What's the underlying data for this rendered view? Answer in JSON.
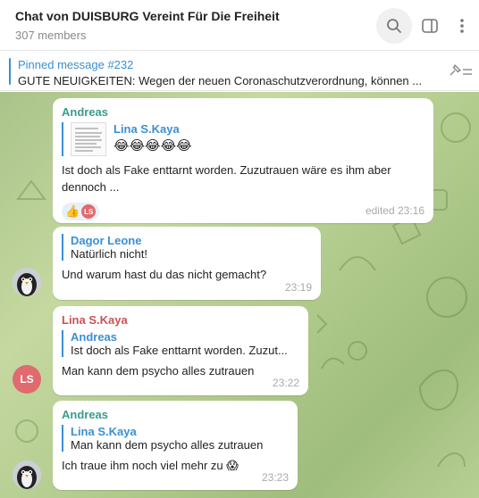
{
  "header": {
    "title": "Chat von DUISBURG Vereint Für Die Freiheit",
    "members": "307 members",
    "icons": [
      "search-icon",
      "side-panel-icon",
      "more-vertical-icon"
    ]
  },
  "pinned": {
    "label": "Pinned message #232",
    "text": "GUTE NEUIGKEITEN:   Wegen der neuen Coronaschutzverordnung, können ..."
  },
  "messages": [
    {
      "sender": "Andreas",
      "reply_name": "Lina S.Kaya",
      "reply_text": "😂😂😂😂😂",
      "text": "Ist doch als Fake enttarnt worden. Zuzutrauen wäre es ihm aber dennoch ...",
      "reaction_emoji": "👍",
      "reaction_user": "LS",
      "time": "edited 23:16"
    },
    {
      "sender": "",
      "reply_name": "Dagor Leone",
      "reply_text": "Natürlich nicht!",
      "text": "Und warum hast du das nicht gemacht?",
      "time": "23:19"
    },
    {
      "sender": "Lina S.Kaya",
      "avatar_initials": "LS",
      "reply_name": "Andreas",
      "reply_text": "Ist doch als Fake enttarnt worden. Zuzut...",
      "text": "Man kann dem psycho alles zutrauen",
      "time": "23:22"
    },
    {
      "sender": "Andreas",
      "reply_name": "Lina S.Kaya",
      "reply_text": "Man kann dem psycho alles zutrauen",
      "text": "Ich traue ihm noch viel mehr zu 😱",
      "time": "23:23"
    }
  ],
  "colors": {
    "accent": "#3a8fd6",
    "sender_andreas": "#3d9a8e",
    "sender_lina": "#c95256",
    "avatar_ls": "#e06a6e"
  }
}
